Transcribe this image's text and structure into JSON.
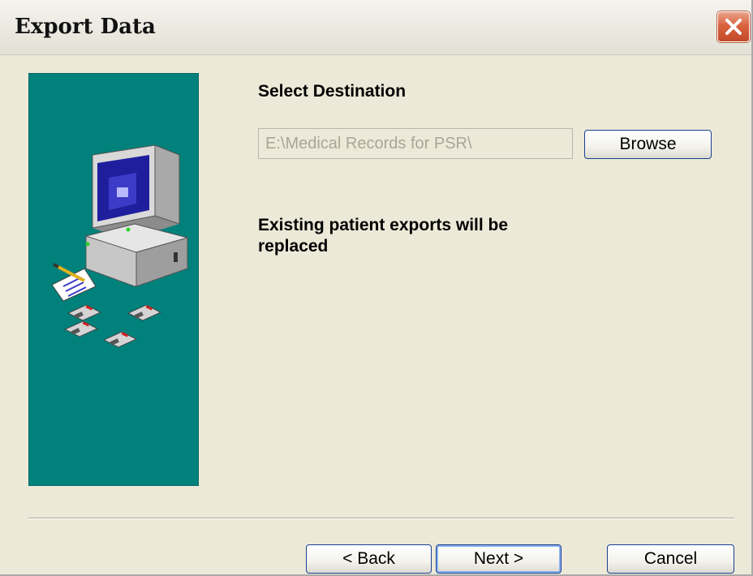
{
  "window": {
    "title": "Export Data"
  },
  "titlebar": {
    "close_icon": "close-icon"
  },
  "side_panel": {
    "illustration": "computer-with-floppy-disks-icon",
    "background": "#00817b"
  },
  "main": {
    "heading": "Select Destination",
    "destination_value": "E:\\Medical Records for PSR\\",
    "browse_label": "Browse",
    "message": "Existing patient exports will be replaced"
  },
  "footer": {
    "back_label": "< Back",
    "next_label": "Next >",
    "cancel_label": "Cancel"
  },
  "colors": {
    "close": "#d9623f",
    "button_border": "#1c3f94",
    "focus_ring": "#88b0eb"
  }
}
